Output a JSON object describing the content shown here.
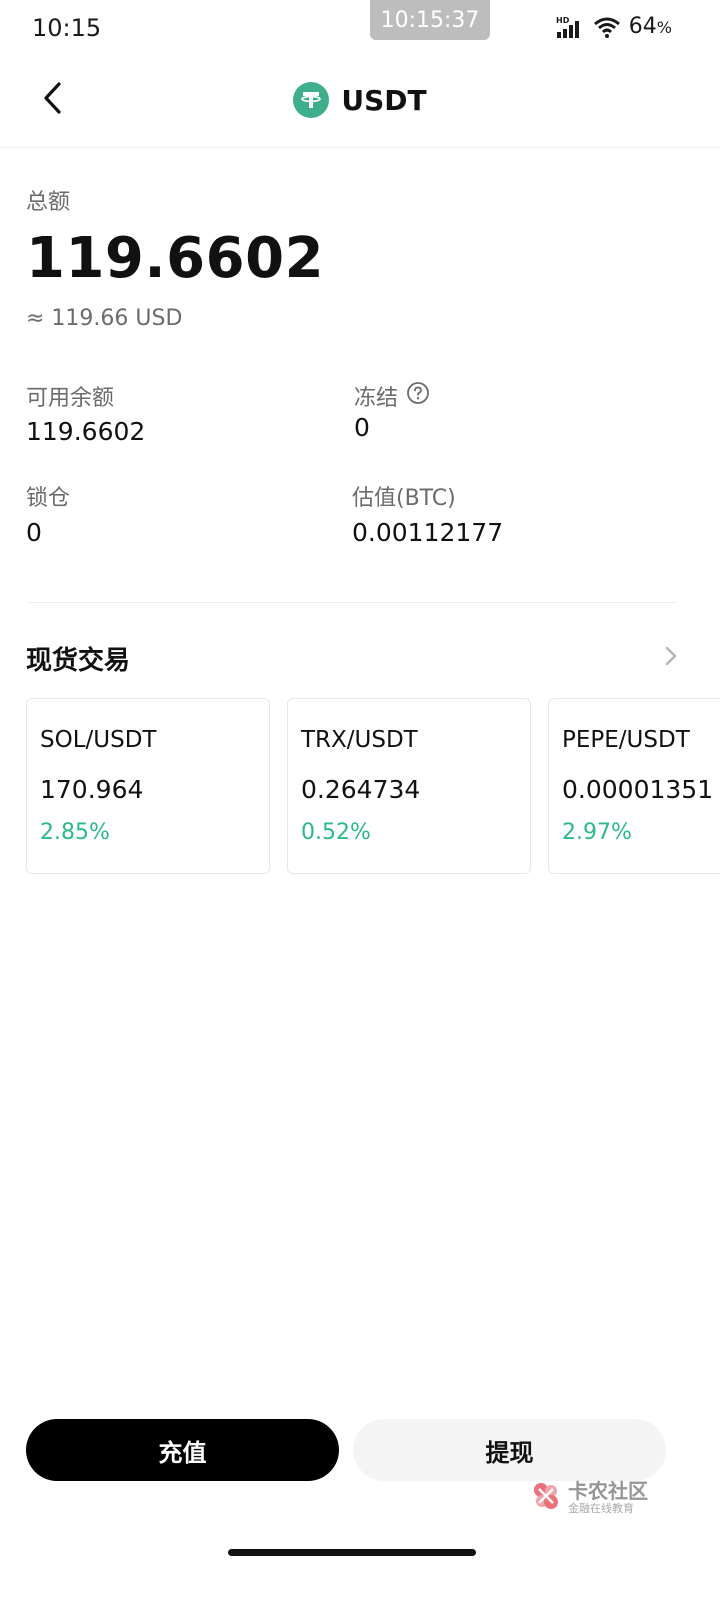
{
  "status_bar": {
    "time": "10:15",
    "clock_pill": "10:15:37",
    "battery": "64",
    "battery_unit": "%",
    "icons": [
      "hd-signal-icon",
      "wifi-icon"
    ]
  },
  "header": {
    "title": "USDT",
    "back_icon": "chevron-left-icon",
    "coin_icon": "tether-logo-icon",
    "coin_color": "#3fae8c"
  },
  "balance": {
    "total_label": "总额",
    "total_amount": "119.6602",
    "total_usd": "≈ 119.66 USD",
    "available_label": "可用余额",
    "available_value": "119.6602",
    "frozen_label": "冻结",
    "frozen_value": "0",
    "locked_label": "锁仓",
    "locked_value": "0",
    "btc_label": "估值(BTC)",
    "btc_value": "0.00112177"
  },
  "spot": {
    "title": "现货交易",
    "cards": [
      {
        "pair": "SOL/USDT",
        "price": "170.964",
        "change": "2.85%"
      },
      {
        "pair": "TRX/USDT",
        "price": "0.264734",
        "change": "0.52%"
      },
      {
        "pair": "PEPE/USDT",
        "price": "0.00001351",
        "change": "2.97%"
      }
    ],
    "change_color": "#2bb98a"
  },
  "actions": {
    "deposit_label": "充值",
    "withdraw_label": "提现"
  },
  "watermark": {
    "main": "卡农社区",
    "sub": "金融在线教育"
  }
}
